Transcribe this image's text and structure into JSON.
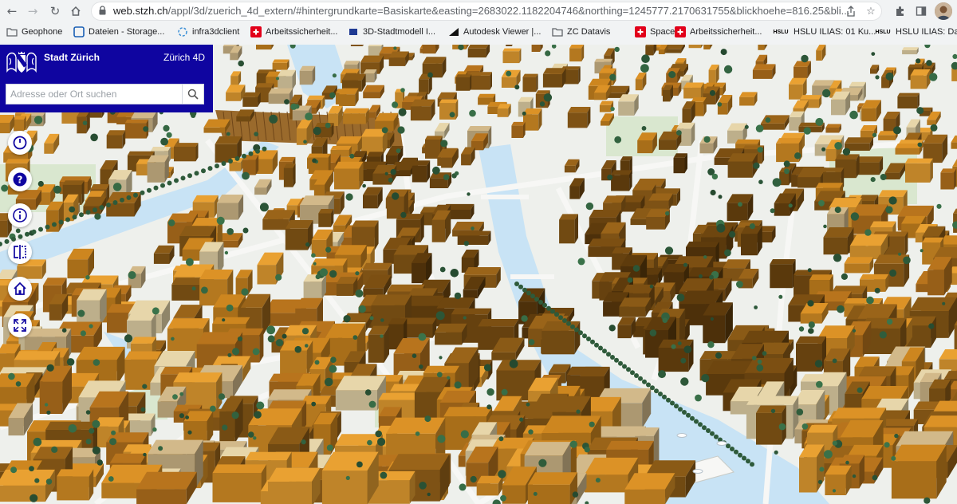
{
  "browser": {
    "url_host": "web.stzh.ch",
    "url_rest": "/appl/3d/zuerich_4d_extern/#hintergrundkarte=Basiskarte&easting=2683022.1182204746&northing=1245777.2170631755&blickhoehe=816.25&bli...",
    "icons": [
      "back-icon",
      "forward-icon",
      "reload-icon",
      "home-icon",
      "lock-icon",
      "share-icon",
      "star-icon",
      "extensions-icon",
      "sidebar-icon"
    ]
  },
  "bookmarks": [
    {
      "label": "Geophone",
      "icon": "folder-icon",
      "color": "#5f6368"
    },
    {
      "label": "Dateien - Storage...",
      "icon": "storage-icon",
      "color": "#1a5fb4"
    },
    {
      "label": "infra3dclient",
      "icon": "infra3d-icon",
      "color": "#3a8fd6"
    },
    {
      "label": "Arbeitssicherheit...",
      "icon": "swiss-cross-icon",
      "color": "#e2001a"
    },
    {
      "label": "3D-Stadtmodell I...",
      "icon": "zurich-icon",
      "color": "#1f3a93"
    },
    {
      "label": "Autodesk Viewer |...",
      "icon": "autodesk-icon",
      "color": "#111111"
    },
    {
      "label": "ZC Datavis",
      "icon": "folder-icon",
      "color": "#5f6368"
    },
    {
      "label": "Spaces",
      "icon": "spaces-icon",
      "color": "#e2001a"
    },
    {
      "label": "Arbeitssicherheit...",
      "icon": "swiss-cross-icon",
      "color": "#e2001a"
    },
    {
      "label": "HSLU ILIAS: 01 Ku...",
      "icon": "hslu-icon",
      "color": "#000000"
    },
    {
      "label": "HSLU ILIAS: Dash",
      "icon": "hslu-icon",
      "color": "#000000"
    }
  ],
  "app": {
    "city": "Stadt Zürich",
    "title": "Zürich 4D",
    "brand_color": "#0f05a0",
    "search_placeholder": "Adresse oder Ort suchen"
  },
  "controls": [
    {
      "name": "time-icon"
    },
    {
      "name": "help-icon"
    },
    {
      "name": "info-icon"
    },
    {
      "name": "compare-icon"
    },
    {
      "name": "home-view-icon"
    },
    {
      "name": "fullscreen-icon"
    }
  ],
  "map": {
    "building_colors": [
      "#5e3b0c",
      "#6e460f",
      "#7c4f12",
      "#8a5a16",
      "#9a6419",
      "#b8741d",
      "#cd861f",
      "#dc9226",
      "#e9a132",
      "#d2b98a",
      "#e7d6aa"
    ],
    "water_color": "#c8e3f5",
    "ground_color": "#eef0ec",
    "tree_color": "#2e5a3a"
  }
}
